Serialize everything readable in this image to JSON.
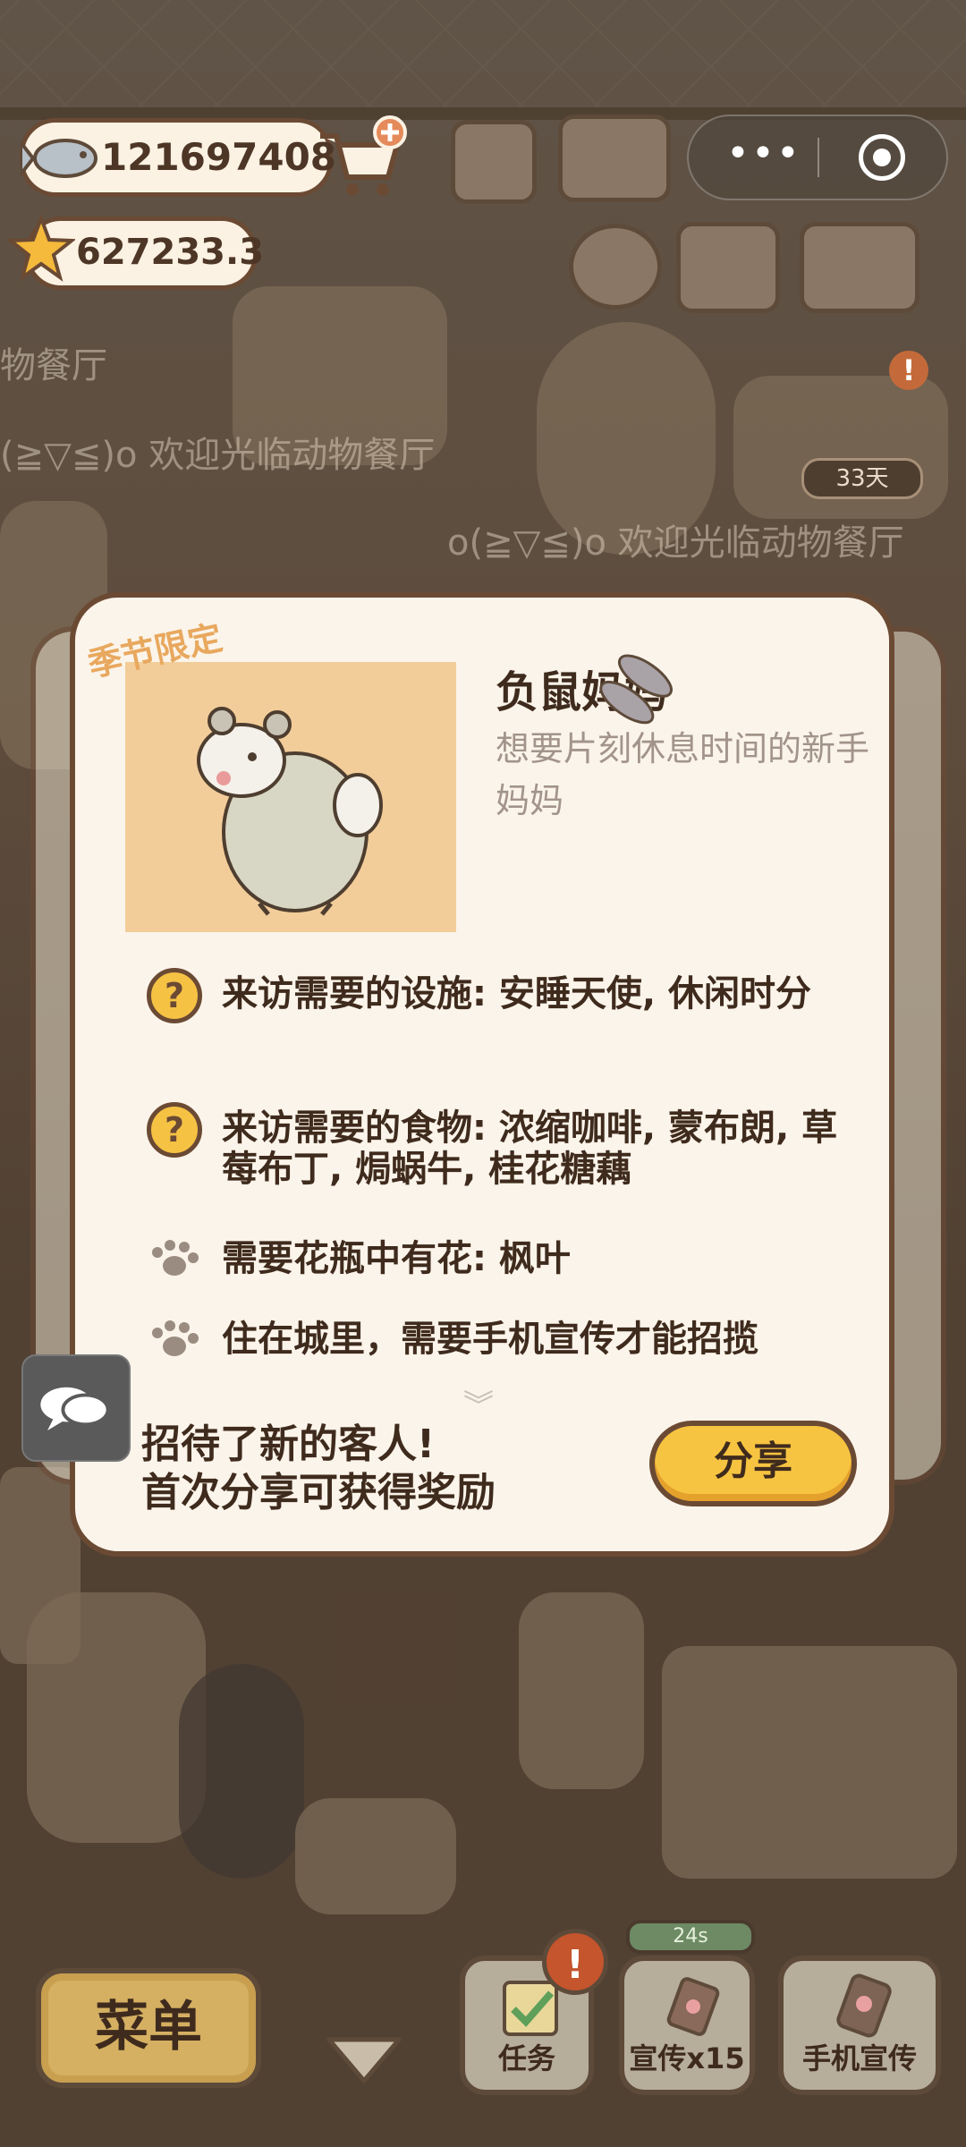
{
  "hud": {
    "fish_count": "121697408",
    "star_count": "627233.3",
    "days_badge": "33天",
    "alert_mark": "!"
  },
  "background": {
    "ticker_1": "(≧▽≦)o 欢迎光临动物餐厅",
    "ticker_2": "o(≧▽≦)o 欢迎光临动物餐厅",
    "ticker_3": "物餐厅"
  },
  "modal": {
    "season_tag": "季节限定",
    "guest_name": "负鼠妈妈",
    "guest_desc": "想要片刻休息时间的新手妈妈",
    "requirements": [
      {
        "icon": "question-icon",
        "text": "来访需要的设施: 安睡天使, 休闲时分"
      },
      {
        "icon": "question-icon",
        "text": "来访需要的食物: 浓缩咖啡, 蒙布朗, 草莓布丁, 焗蜗牛, 桂花糖藕"
      },
      {
        "icon": "paw-icon",
        "text": "需要花瓶中有花: 枫叶"
      },
      {
        "icon": "paw-icon",
        "text": "住在城里，需要手机宣传才能招揽"
      }
    ],
    "share_line1": "招待了新的客人!",
    "share_line2": "首次分享可获得奖励",
    "share_button": "分享"
  },
  "bottom": {
    "menu_button": "菜单",
    "task_button": "任务",
    "promo_button": "宣传x15",
    "phone_promo_button": "手机宣传",
    "timer": "24s",
    "task_alert": "!"
  },
  "colors": {
    "frame_brown": "#6b4a34",
    "modal_bg": "#fbf4ea",
    "share_yellow": "#f7c441",
    "season_orange": "#e8a85e"
  }
}
